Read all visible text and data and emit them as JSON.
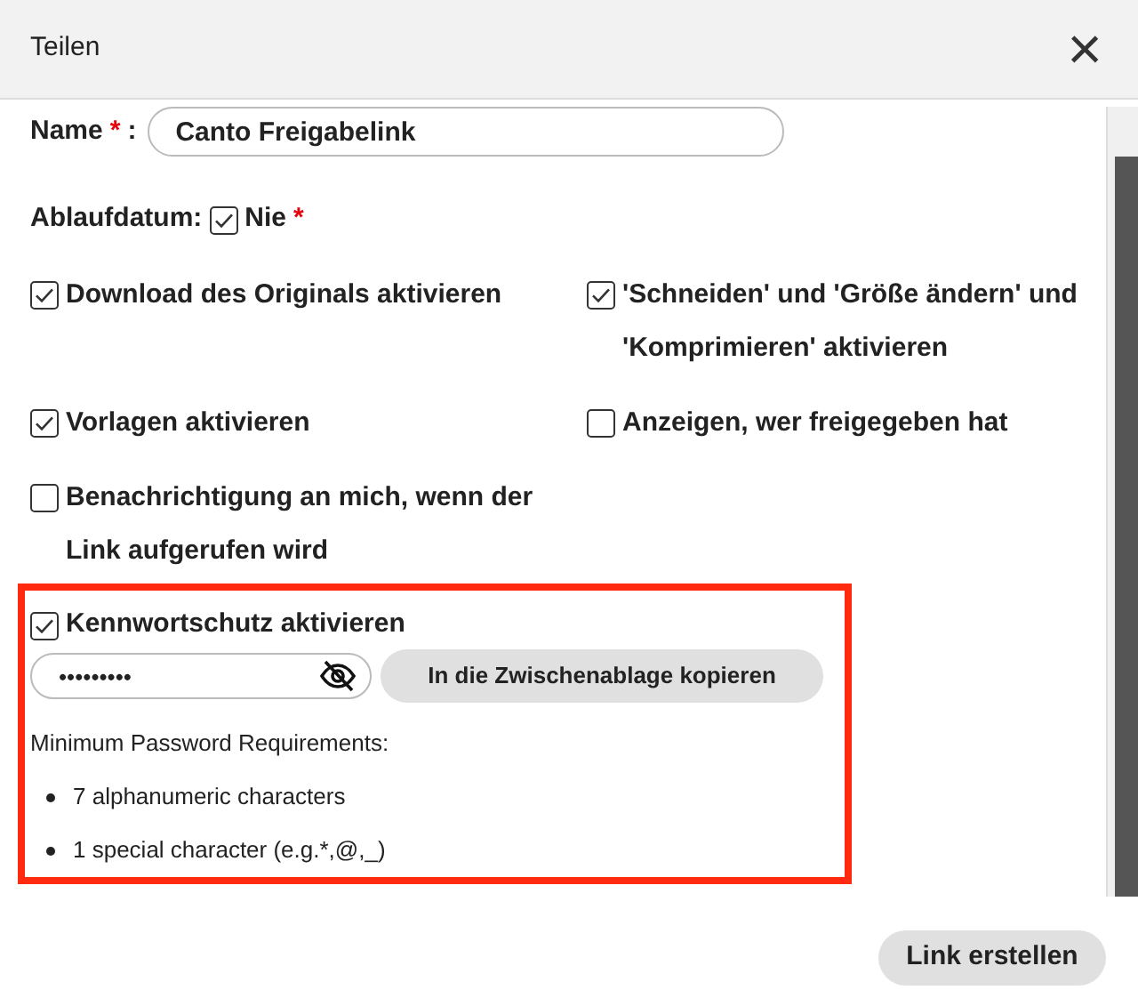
{
  "dialog": {
    "title": "Teilen",
    "close": "×"
  },
  "name_field": {
    "label": "Name",
    "required": "*",
    "colon": ":",
    "value": "Canto Freigabelink"
  },
  "expiry": {
    "label": "Ablaufdatum:",
    "option": "Nie",
    "checked": true,
    "required": "*"
  },
  "options": [
    {
      "label": "Download des Originals aktivieren",
      "checked": true
    },
    {
      "label": "'Schneiden' und 'Größe ändern' und 'Komprimieren' aktivieren",
      "checked": true
    },
    {
      "label": "Vorlagen aktivieren",
      "checked": true
    },
    {
      "label": "Anzeigen, wer freigegeben hat",
      "checked": false
    },
    {
      "label": "Benachrichtigung an mich, wenn der Link aufgerufen wird",
      "checked": false
    }
  ],
  "password": {
    "label": "Kennwortschutz aktivieren",
    "checked": true,
    "value": "•••••••••",
    "copy_button": "In die Zwischenablage kopieren",
    "requirements_title": "Minimum Password Requirements:",
    "requirements": [
      "7 alphanumeric characters",
      "1 special character (e.g.*,@,_)"
    ]
  },
  "footer": {
    "button": "Link erstellen"
  }
}
